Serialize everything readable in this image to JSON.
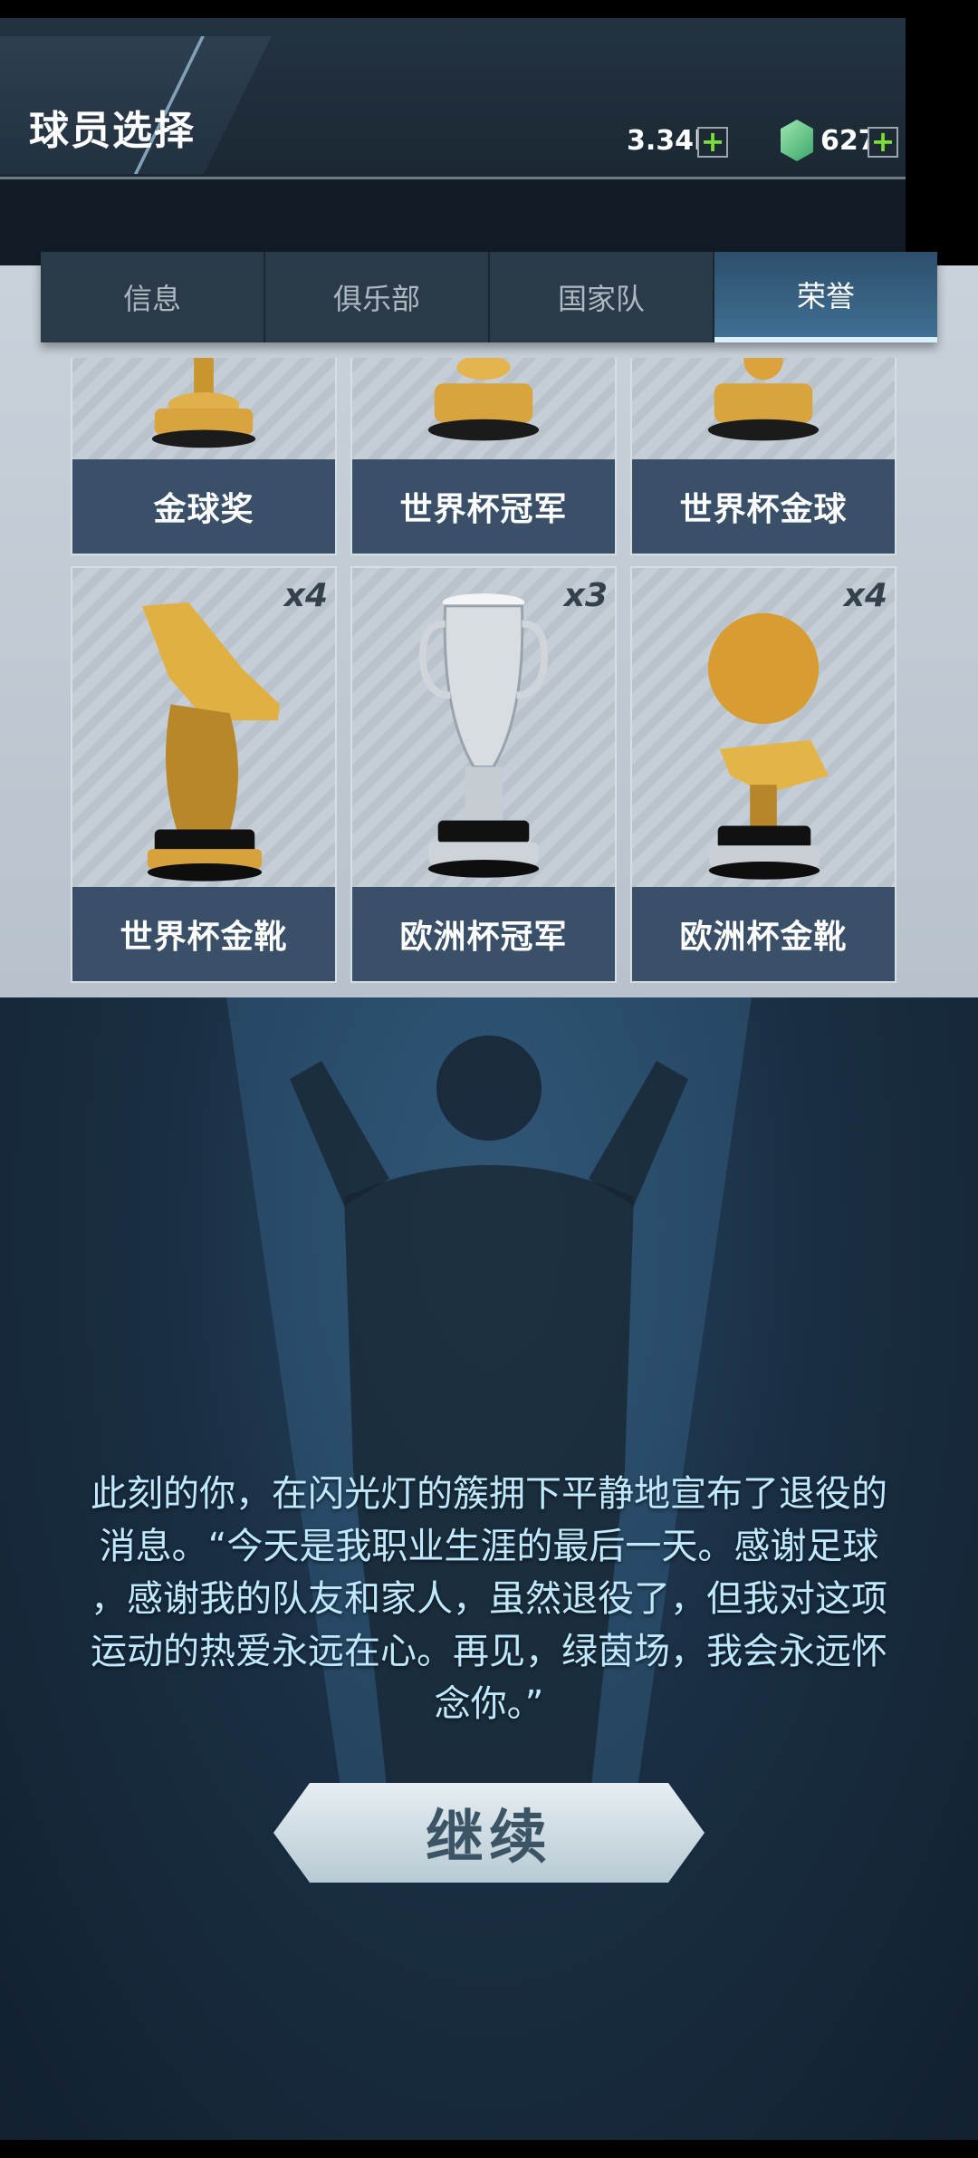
{
  "header": {
    "title": "球员选择",
    "coins": "3.34M",
    "gems": "627",
    "plus": "+"
  },
  "tabs": [
    {
      "label": "信息",
      "active": false
    },
    {
      "label": "俱乐部",
      "active": false
    },
    {
      "label": "国家队",
      "active": false
    },
    {
      "label": "荣誉",
      "active": true
    }
  ],
  "honors": [
    {
      "label": "金球奖",
      "count": ""
    },
    {
      "label": "世界杯冠军",
      "count": ""
    },
    {
      "label": "世界杯金球",
      "count": ""
    },
    {
      "label": "世界杯金靴",
      "count": "x4"
    },
    {
      "label": "欧洲杯冠军",
      "count": "x3"
    },
    {
      "label": "欧洲杯金靴",
      "count": "x4"
    }
  ],
  "story": {
    "text_lines": [
      "此刻的你，在闪光灯的簇拥下平静地宣布了退役的",
      "消息。“今天是我职业生涯的最后一天。感谢足球",
      "，感谢我的队友和家人，虽然退役了，但我对这项",
      "运动的热爱永远在心。再见，绿茵场，我会永远怀",
      "念你。”"
    ],
    "continue_label": "继续"
  },
  "colors": {
    "accent_tab": "#3f6f93",
    "label_bg": "#3a5068",
    "story_text": "#bfe9ff",
    "plus_green": "#7dde39"
  }
}
